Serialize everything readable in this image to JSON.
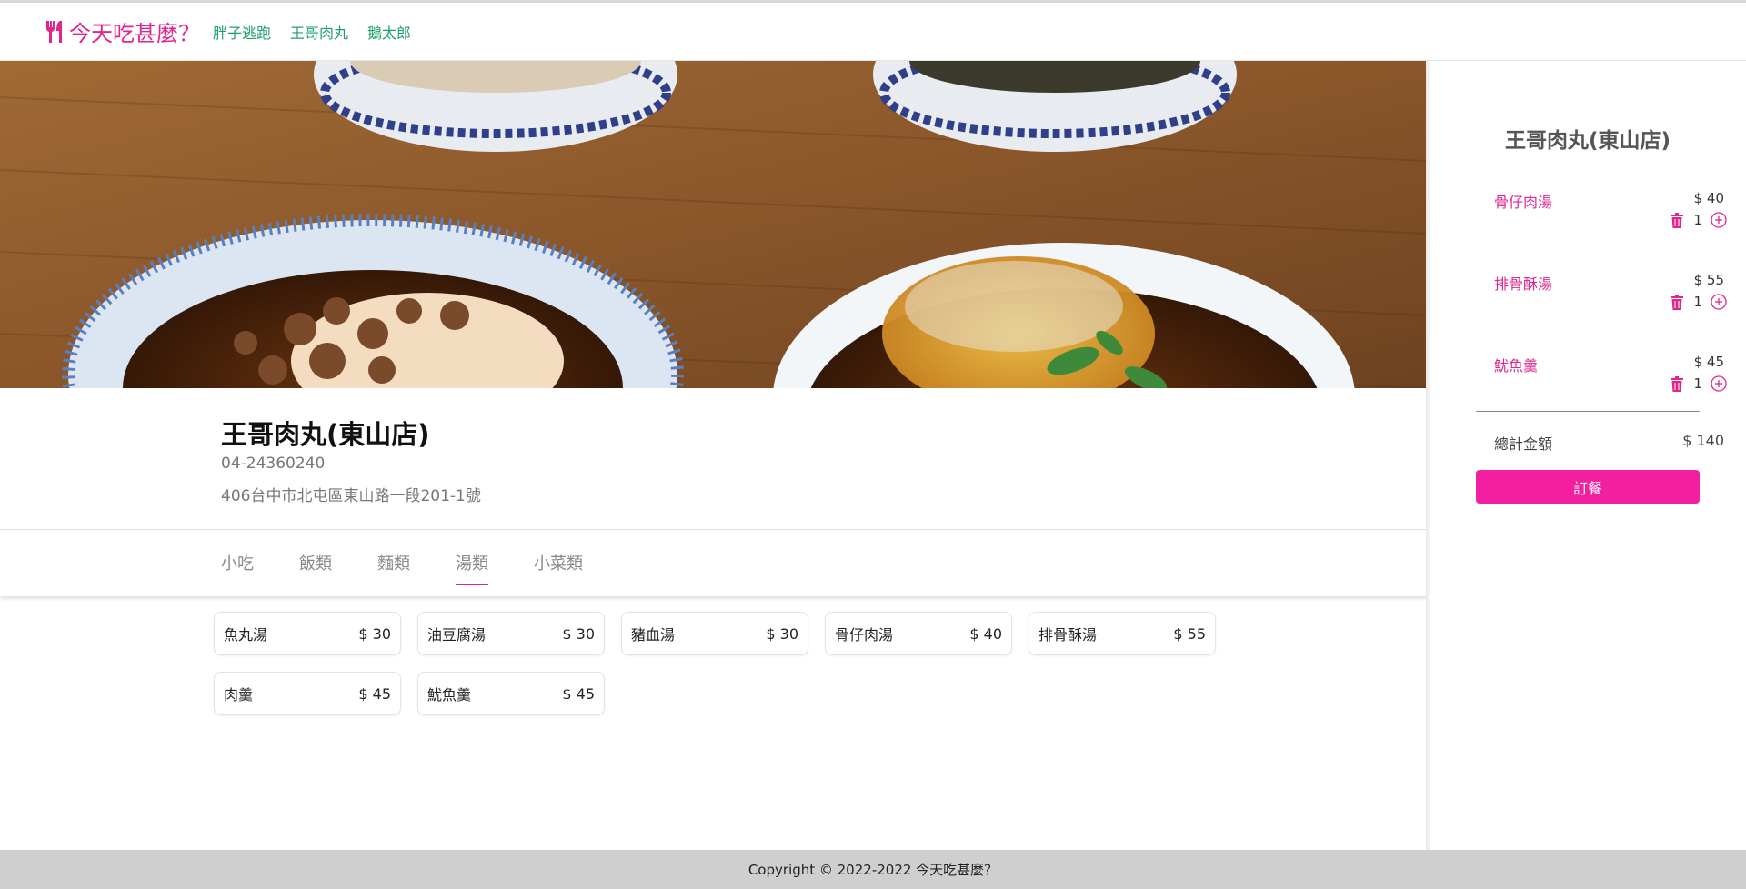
{
  "brand": {
    "name": "今天吃甚麼？",
    "icon": "utensils-icon",
    "color": "#e0258c"
  },
  "nav": {
    "links": [
      "胖子逃跑",
      "王哥肉丸",
      "鵝太郎"
    ],
    "color": "#22a06b"
  },
  "shop": {
    "name": "王哥肉丸(東山店)",
    "phone": "04-24360240",
    "address": "406台中市北屯區東山路一段201-1號"
  },
  "tabs": {
    "items": [
      "小吃",
      "飯類",
      "麵類",
      "湯類",
      "小菜類"
    ],
    "active": "湯類"
  },
  "menu": {
    "items": [
      {
        "name": "魚丸湯",
        "price": "$ 30"
      },
      {
        "name": "油豆腐湯",
        "price": "$ 30"
      },
      {
        "name": "豬血湯",
        "price": "$ 30"
      },
      {
        "name": "骨仔肉湯",
        "price": "$ 40"
      },
      {
        "name": "排骨酥湯",
        "price": "$ 55"
      },
      {
        "name": "肉羹",
        "price": "$ 45"
      },
      {
        "name": "魷魚羹",
        "price": "$ 45"
      }
    ]
  },
  "cart": {
    "title": "王哥肉丸(東山店)",
    "items": [
      {
        "name": "骨仔肉湯",
        "price": "$ 40",
        "qty": "1"
      },
      {
        "name": "排骨酥湯",
        "price": "$ 55",
        "qty": "1"
      },
      {
        "name": "魷魚羹",
        "price": "$ 45",
        "qty": "1"
      }
    ],
    "total_label": "總計金額",
    "total_value": "$ 140",
    "order_label": "訂餐",
    "accent": "#f21fa0"
  },
  "footer": {
    "text": "Copyright © 2022-2022 今天吃甚麼？"
  }
}
